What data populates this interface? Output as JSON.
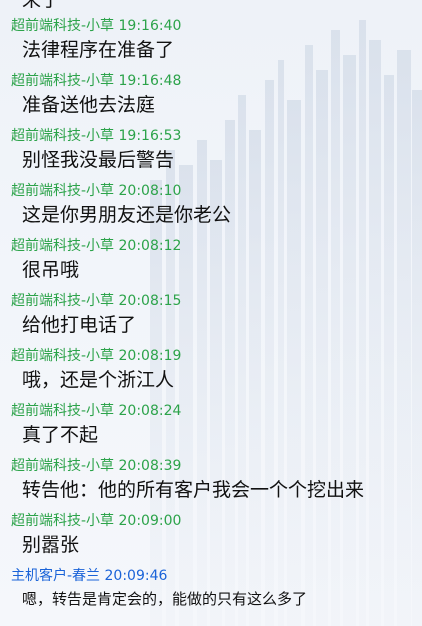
{
  "colors": {
    "peer_sender": "#2ca34a",
    "self_sender": "#1a63d8",
    "message_text": "#111111",
    "background": "#eef2f8"
  },
  "partial_top_text": "来了",
  "messages": [
    {
      "sender": "超前端科技-小草",
      "time": "19:16:40",
      "text": "法律程序在准备了",
      "side": "peer"
    },
    {
      "sender": "超前端科技-小草",
      "time": "19:16:48",
      "text": "准备送他去法庭",
      "side": "peer"
    },
    {
      "sender": "超前端科技-小草",
      "time": "19:16:53",
      "text": "别怪我没最后警告",
      "side": "peer"
    },
    {
      "sender": "超前端科技-小草",
      "time": "20:08:10",
      "text": "这是你男朋友还是你老公",
      "side": "peer"
    },
    {
      "sender": "超前端科技-小草",
      "time": "20:08:12",
      "text": "很吊哦",
      "side": "peer"
    },
    {
      "sender": "超前端科技-小草",
      "time": "20:08:15",
      "text": "给他打电话了",
      "side": "peer"
    },
    {
      "sender": "超前端科技-小草",
      "time": "20:08:19",
      "text": "哦，还是个浙江人",
      "side": "peer"
    },
    {
      "sender": "超前端科技-小草",
      "time": "20:08:24",
      "text": "真了不起",
      "side": "peer"
    },
    {
      "sender": "超前端科技-小草",
      "time": "20:08:39",
      "text": "转告他：他的所有客户我会一个个挖出来",
      "side": "peer"
    },
    {
      "sender": "超前端科技-小草",
      "time": "20:09:00",
      "text": "别嚣张",
      "side": "peer"
    },
    {
      "sender": "主机客户-春兰",
      "time": "20:09:46",
      "text": "嗯，转告是肯定会的，能做的只有这么多了",
      "side": "self"
    }
  ]
}
